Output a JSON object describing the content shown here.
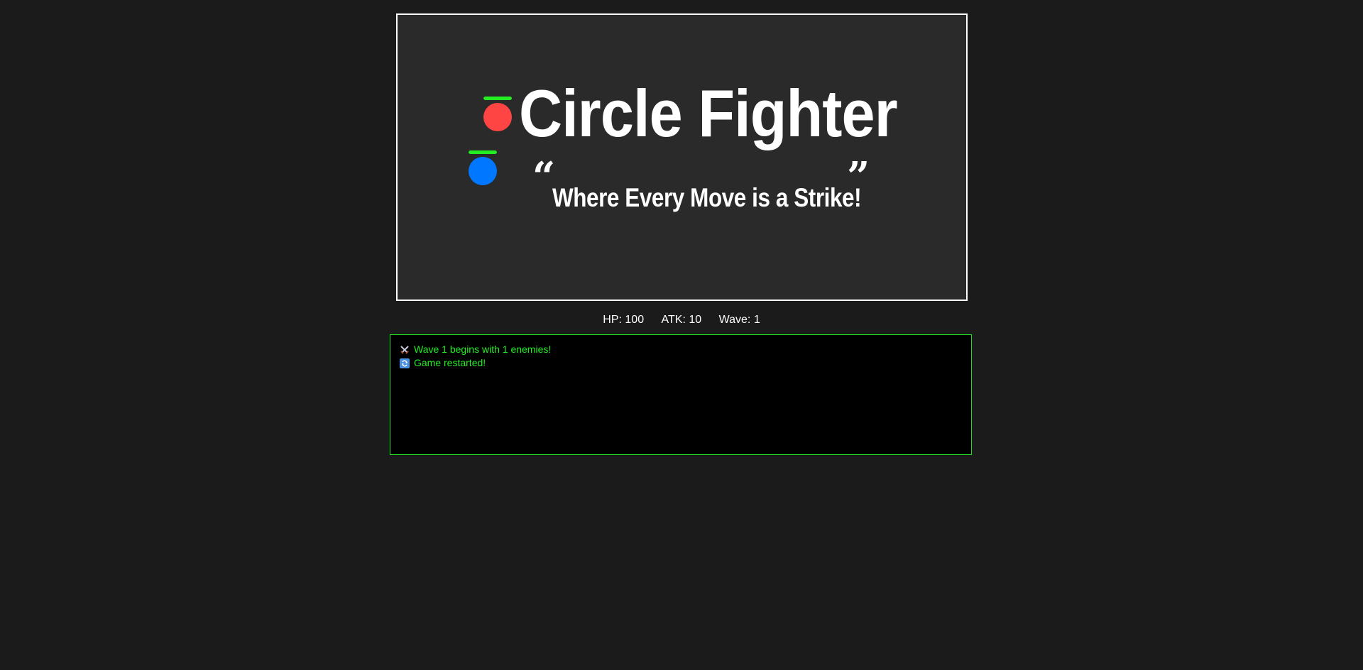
{
  "game": {
    "title": "Circle Fighter",
    "tagline": "Where Every Move is a Strike!",
    "quote_open": "“",
    "quote_close": "”",
    "enemy": {
      "color": "#ff4444",
      "hp_fraction": 1.0
    },
    "player": {
      "color": "#0077ff",
      "hp_fraction": 1.0
    }
  },
  "stats": {
    "hp": "HP: 100",
    "atk": "ATK: 10",
    "wave": "Wave: 1"
  },
  "log": {
    "entries": [
      {
        "icon": "crossed-swords-icon",
        "text": "Wave 1 begins with 1 enemies!"
      },
      {
        "icon": "restart-icon",
        "text": "Game restarted!"
      }
    ]
  },
  "colors": {
    "background": "#1b1b1b",
    "canvas": "#2a2a2a",
    "log_text": "#22ee22",
    "hp_bar": "#22ee22"
  }
}
